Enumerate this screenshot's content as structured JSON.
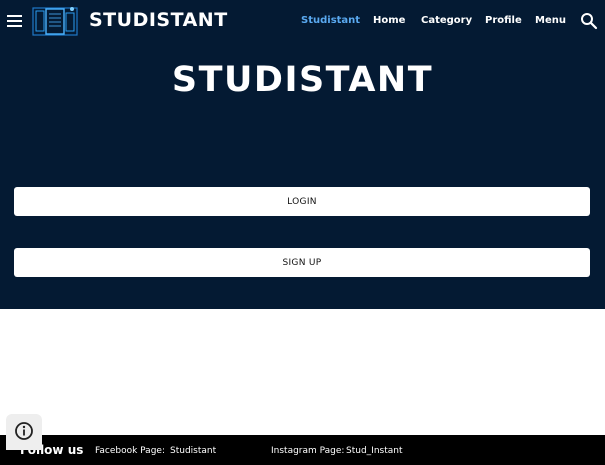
{
  "header": {
    "site_name": "STUDISTANT",
    "nav": [
      {
        "label": "Studistant",
        "active": true
      },
      {
        "label": "Home"
      },
      {
        "label": "Category"
      },
      {
        "label": "Profile"
      },
      {
        "label": "Menu"
      }
    ],
    "icons": {
      "menu": "hamburger-icon",
      "logo": "logo-icon",
      "search": "search-icon"
    }
  },
  "hero": {
    "title": "STUDISTANT",
    "login_label": "LOGIN",
    "signup_label": "SIGN UP"
  },
  "footer": {
    "follow_label": "Follow us",
    "facebook_label": "Facebook Page:",
    "facebook_value": "Studistant",
    "instagram_label": "Instagram Page:",
    "instagram_value": "Stud_Instant"
  },
  "widgets": {
    "info_icon": "info-icon"
  },
  "colors": {
    "hero_bg": "#041a33",
    "active_nav": "#5aa9f0",
    "footer_bg": "#000000",
    "button_bg": "#ffffff"
  }
}
